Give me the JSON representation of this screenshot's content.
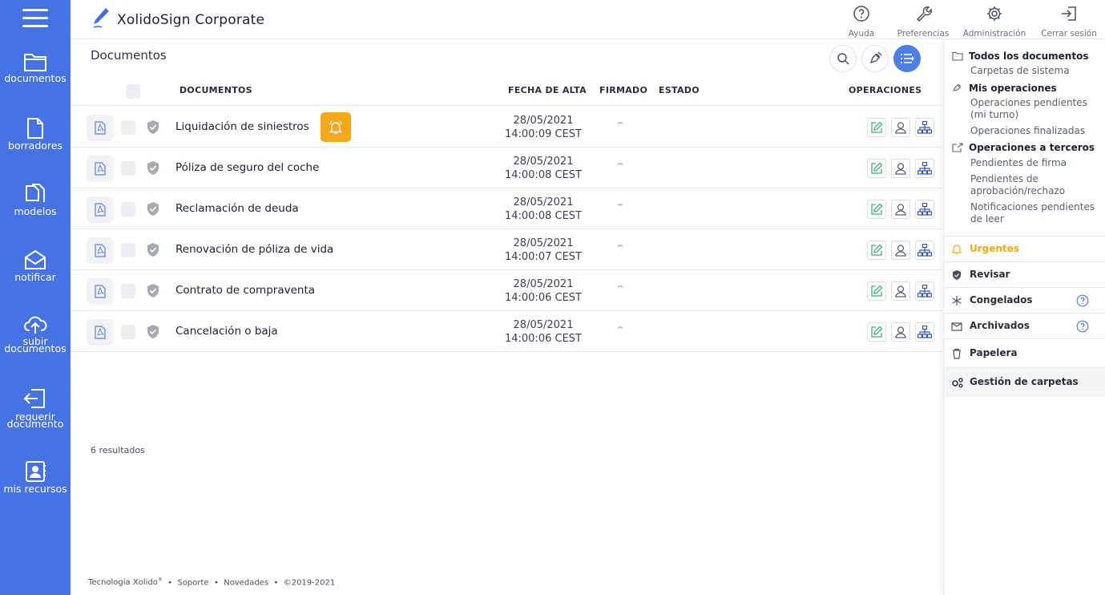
{
  "app": {
    "title": "XolidoSign Corporate"
  },
  "sidebar": {
    "items": [
      {
        "label": "documentos",
        "icon": "folder-icon"
      },
      {
        "label": "borradores",
        "icon": "draft-file-icon"
      },
      {
        "label": "modelos",
        "icon": "models-copy-icon"
      },
      {
        "label": "notificar",
        "icon": "notify-envelope-icon"
      },
      {
        "label": "subir\ndocumentos",
        "icon": "cloud-upload-icon"
      },
      {
        "label": "requerir\ndocumento",
        "icon": "request-import-icon"
      },
      {
        "label": "mis recursos",
        "icon": "contacts-book-icon"
      }
    ]
  },
  "header": {
    "actions": [
      {
        "label": "Ayuda",
        "icon": "help-circle-icon"
      },
      {
        "label": "Preferencias",
        "icon": "wrench-icon"
      },
      {
        "label": "Administración",
        "icon": "gear-icon"
      },
      {
        "label": "Cerrar sesión",
        "icon": "logout-icon"
      }
    ]
  },
  "main": {
    "page_title": "Documentos",
    "columns": {
      "documents": "DOCUMENTOS",
      "created": "FECHA DE ALTA",
      "signed": "FIRMADO",
      "status": "ESTADO",
      "operations": "OPERACIONES"
    },
    "rows": [
      {
        "name": "Liquidación de siniestros",
        "date": "28/05/2021",
        "time": "14:00:09 CEST",
        "urgent": true
      },
      {
        "name": "Póliza de seguro del coche",
        "date": "28/05/2021",
        "time": "14:00:08 CEST",
        "urgent": false
      },
      {
        "name": "Reclamación de deuda",
        "date": "28/05/2021",
        "time": "14:00:08 CEST",
        "urgent": false
      },
      {
        "name": "Renovación de póliza de vida",
        "date": "28/05/2021",
        "time": "14:00:07 CEST",
        "urgent": false
      },
      {
        "name": "Contrato de compraventa",
        "date": "28/05/2021",
        "time": "14:00:06 CEST",
        "urgent": false
      },
      {
        "name": "Cancelación o baja",
        "date": "28/05/2021",
        "time": "14:00:06 CEST",
        "urgent": false
      }
    ],
    "results": "6 resultados"
  },
  "footer": {
    "brand": "Tecnología Xolido",
    "brand_mark": "®",
    "support": "Soporte",
    "news": "Novedades",
    "copyright": "©2019-2021",
    "separator": "•"
  },
  "right_panel": {
    "all_docs": "Todos los documentos",
    "system_folders": "Carpetas de sistema",
    "my_ops": "Mis operaciones",
    "pending_my_turn": "Operaciones pendientes (mi turno)",
    "finished": "Operaciones finalizadas",
    "third_party": "Operaciones a terceros",
    "pending_signature": "Pendientes de firma",
    "pending_approval": "Pendientes de aprobación/rechazo",
    "pending_notifications": "Notificaciones pendientes de leer",
    "urgent": "Urgentes",
    "review": "Revisar",
    "frozen": "Congelados",
    "archived": "Archivados",
    "trash": "Papelera",
    "folder_mgmt": "Gestión de carpetas"
  },
  "colors": {
    "sidebar": "#4573e3",
    "urgent": "#f5a81c",
    "accent": "#4f7ee8",
    "edit": "#3cb371",
    "tree": "#3455b5"
  }
}
